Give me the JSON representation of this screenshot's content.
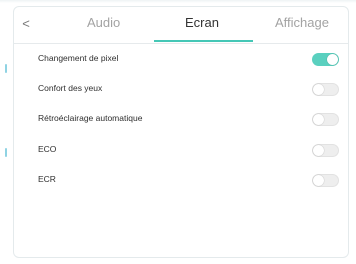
{
  "tabs": {
    "back_icon": "chevron-left-icon",
    "back_glyph": "<",
    "items": [
      {
        "label": "Audio",
        "active": false
      },
      {
        "label": "Ecran",
        "active": true
      },
      {
        "label": "Affichage",
        "active": false
      }
    ]
  },
  "settings": [
    {
      "label": "Changement de pixel",
      "on": true
    },
    {
      "label": "Confort des yeux",
      "on": false
    },
    {
      "label": "Rétroéclairage automatique",
      "on": false
    },
    {
      "label": "ECO",
      "on": false
    },
    {
      "label": "ECR",
      "on": false
    }
  ],
  "colors": {
    "accent": "#45c7b6",
    "toggle_on": "#5ad0bf",
    "toggle_off": "#eeeeee",
    "text": "#2f2f2f",
    "tab_inactive": "#a3a3a3",
    "side_mark": "#8fd3e3"
  }
}
